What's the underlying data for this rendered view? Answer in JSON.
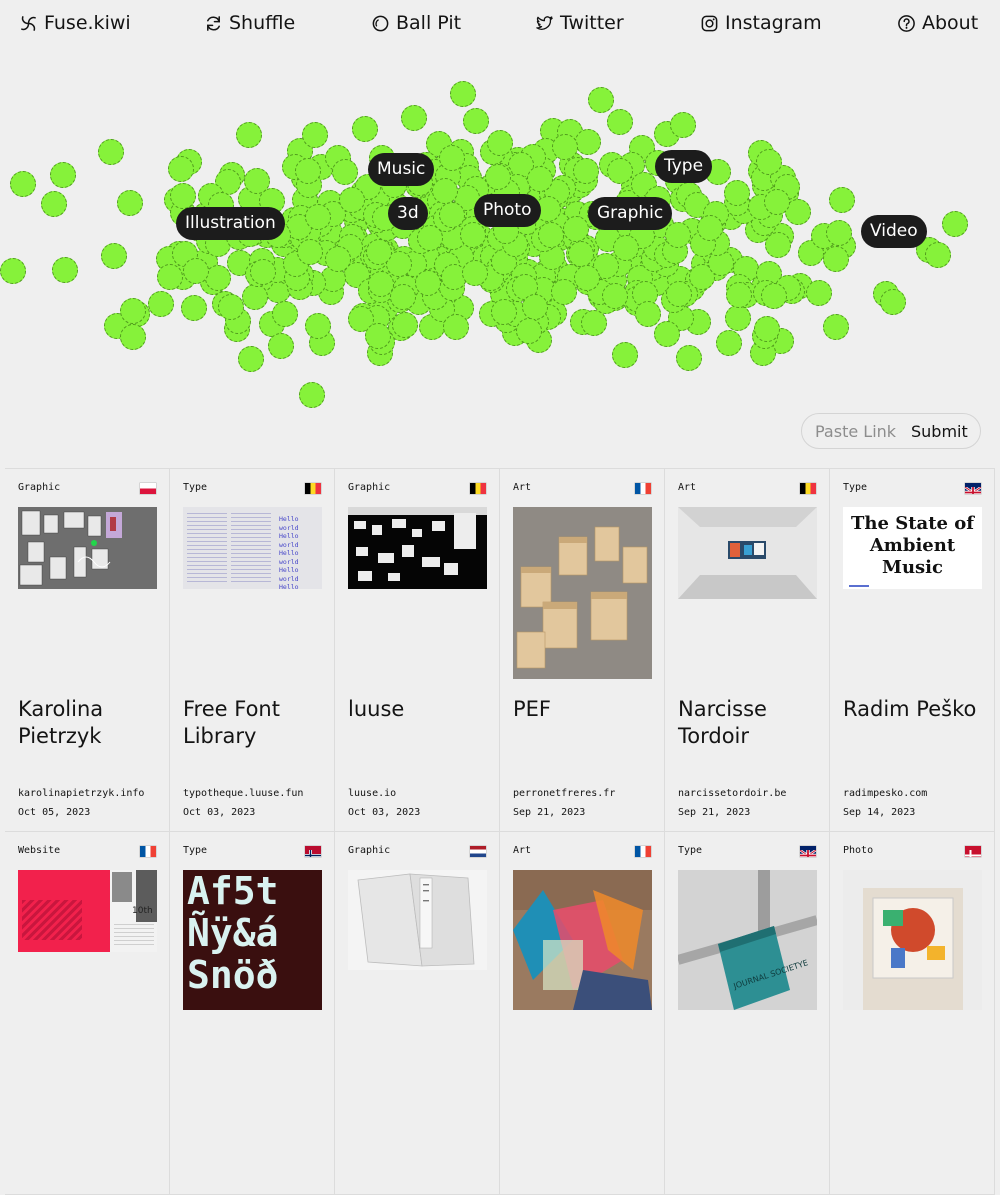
{
  "nav": {
    "logo": "Fuse.kiwi",
    "shuffle": "Shuffle",
    "ball_pit": "Ball Pit",
    "twitter": "Twitter",
    "instagram": "Instagram",
    "about": "About"
  },
  "pit": {
    "ball_color": "#86f23a",
    "categories": [
      "Music",
      "Type",
      "Illustration",
      "3d",
      "Photo",
      "Graphic",
      "Video"
    ]
  },
  "submit_box": {
    "placeholder": "Paste Link",
    "button": "Submit"
  },
  "cards": [
    {
      "category": "Graphic",
      "country": "Poland",
      "title": "Karolina Pietrzyk",
      "url": "karolinapietrzyk.info",
      "date": "Oct 05, 2023"
    },
    {
      "category": "Type",
      "country": "Belgium",
      "title": "Free Font Library",
      "url": "typotheque.luuse.fun",
      "date": "Oct 03, 2023"
    },
    {
      "category": "Graphic",
      "country": "Belgium",
      "title": "luuse",
      "url": "luuse.io",
      "date": "Oct 03, 2023"
    },
    {
      "category": "Art",
      "country": "France",
      "title": "PEF",
      "url": "perronetfreres.fr",
      "date": "Sep 21, 2023"
    },
    {
      "category": "Art",
      "country": "Belgium",
      "title": "Narcisse Tordoir",
      "url": "narcissetordoir.be",
      "date": "Sep 21, 2023"
    },
    {
      "category": "Type",
      "country": "United Kingdom",
      "title": "Radim Peško",
      "url": "radimpesko.com",
      "date": "Sep 14, 2023"
    },
    {
      "category": "Website",
      "country": "France",
      "title": "",
      "url": "",
      "date": ""
    },
    {
      "category": "Type",
      "country": "Norway",
      "title": "",
      "url": "",
      "date": ""
    },
    {
      "category": "Graphic",
      "country": "Netherlands",
      "title": "",
      "url": "",
      "date": ""
    },
    {
      "category": "Art",
      "country": "France",
      "title": "",
      "url": "",
      "date": ""
    },
    {
      "category": "Type",
      "country": "United Kingdom",
      "title": "",
      "url": "",
      "date": ""
    },
    {
      "category": "Photo",
      "country": "Denmark",
      "title": "",
      "url": "",
      "date": ""
    }
  ],
  "thumb_text": {
    "hello_world": "Hello world",
    "ambient_title": "The State of Ambient Music",
    "font_specimen_1": "Af5t",
    "font_specimen_2": "Ñÿ&á",
    "font_specimen_3": "Snöð",
    "side_10th": "10th",
    "book_spine": "JOURNAL SOCIETYE"
  }
}
